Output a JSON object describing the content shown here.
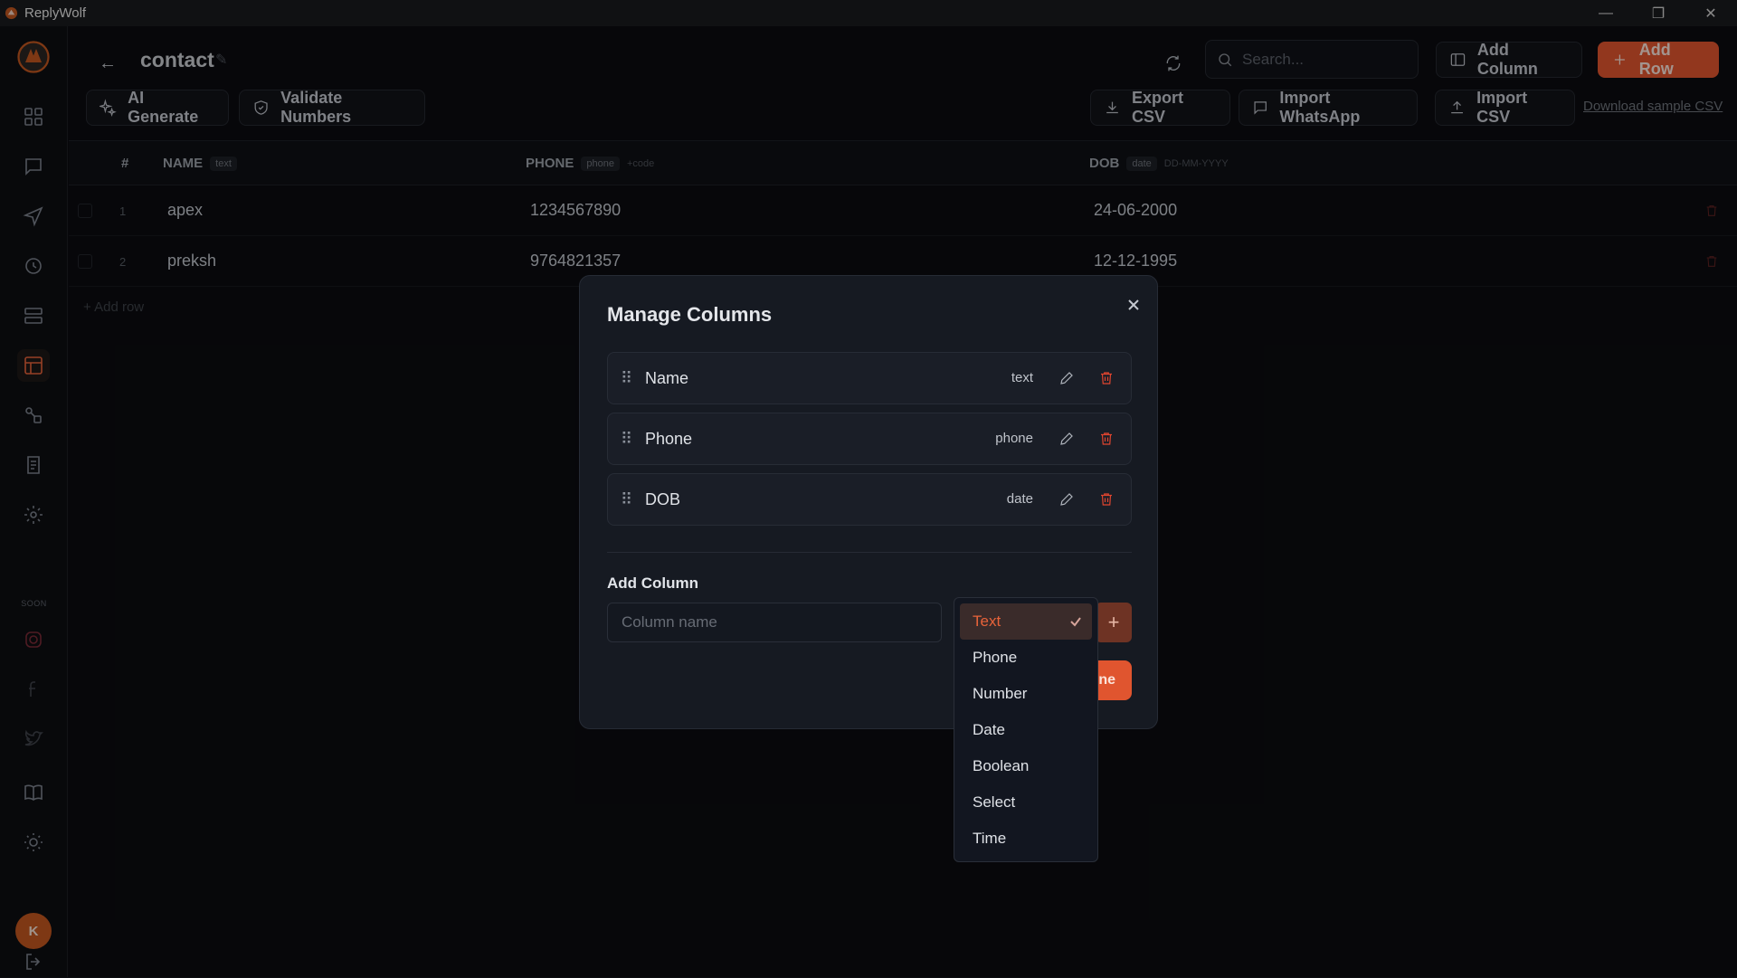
{
  "app": {
    "title": "ReplyWolf"
  },
  "window": {
    "minimize": "—",
    "restore": "❐",
    "close": "✕"
  },
  "sidebar": {
    "items": [
      {
        "name": "dashboard-icon"
      },
      {
        "name": "chat-icon"
      },
      {
        "name": "send-icon"
      },
      {
        "name": "history-icon"
      },
      {
        "name": "templates-icon"
      },
      {
        "name": "table-icon",
        "active": true
      },
      {
        "name": "flows-icon"
      },
      {
        "name": "logs-icon"
      },
      {
        "name": "settings-icon"
      }
    ],
    "soon_label": "SOON",
    "soon_items": [
      {
        "name": "instagram-icon"
      },
      {
        "name": "facebook-icon"
      },
      {
        "name": "twitter-icon"
      }
    ],
    "bottom_items": [
      {
        "name": "book-icon"
      },
      {
        "name": "theme-icon"
      }
    ],
    "avatar_initial": "K"
  },
  "header": {
    "back": "←",
    "title": "contact",
    "search_placeholder": "Search...",
    "add_column": "Add Column",
    "add_row": "Add Row",
    "ai_generate": "AI Generate",
    "validate_numbers": "Validate Numbers",
    "export_csv": "Export CSV",
    "import_whatsapp": "Import WhatsApp",
    "import_csv": "Import CSV",
    "download_sample": "Download sample CSV"
  },
  "table": {
    "columns": [
      {
        "label": "#"
      },
      {
        "label": "NAME",
        "tag": "text"
      },
      {
        "label": "PHONE",
        "tag": "phone",
        "hint": "+code"
      },
      {
        "label": "DOB",
        "tag": "date",
        "hint": "DD-MM-YYYY"
      }
    ],
    "rows": [
      {
        "num": "1",
        "name": "apex",
        "phone": "1234567890",
        "dob": "24-06-2000"
      },
      {
        "num": "2",
        "name": "preksh",
        "phone": "9764821357",
        "dob": "12-12-1995"
      }
    ],
    "add_row": "+  Add row"
  },
  "modal": {
    "title": "Manage Columns",
    "columns": [
      {
        "name": "Name",
        "type": "text"
      },
      {
        "name": "Phone",
        "type": "phone"
      },
      {
        "name": "DOB",
        "type": "date"
      }
    ],
    "add_column_label": "Add Column",
    "column_name_placeholder": "Column name",
    "add_plus": "+",
    "done_partial": "ne"
  },
  "type_dropdown": {
    "selected": "Text",
    "options": [
      "Text",
      "Phone",
      "Number",
      "Date",
      "Boolean",
      "Select",
      "Time"
    ]
  },
  "colors": {
    "accent": "#e0552f",
    "background": "#0b0c10",
    "modal": "#161a22",
    "danger": "#e0452f"
  }
}
